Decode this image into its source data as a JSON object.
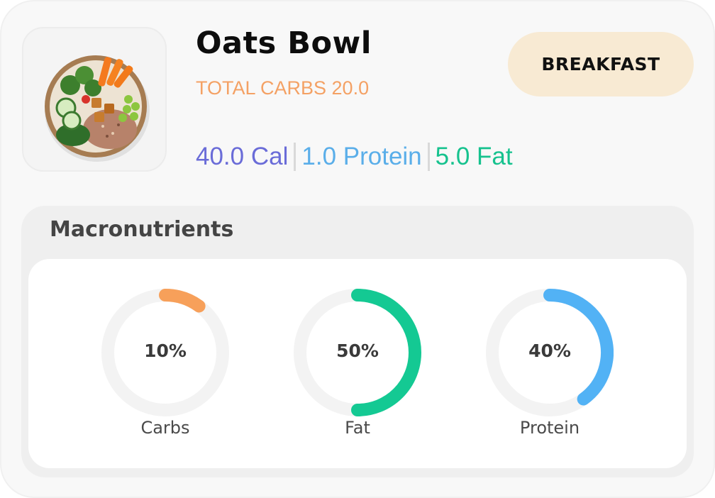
{
  "meal": {
    "title": "Oats Bowl",
    "total_carbs": "TOTAL CARBS 20.0",
    "category": "BREAKFAST",
    "image_icon": "food-bowl-image"
  },
  "stats": {
    "calories": "40.0 Cal",
    "protein": "1.0 Protein",
    "fat": "5.0 Fat"
  },
  "macros": {
    "heading": "Macronutrients",
    "items": [
      {
        "key": "carbs",
        "label": "Carbs",
        "percent_text": "10%",
        "percent": 10,
        "color": "#f7a05a"
      },
      {
        "key": "fat",
        "label": "Fat",
        "percent_text": "50%",
        "percent": 50,
        "color": "#14c993"
      },
      {
        "key": "protein",
        "label": "Protein",
        "percent_text": "40%",
        "percent": 40,
        "color": "#52b2f5"
      }
    ],
    "track_color": "#f3f3f3"
  },
  "colors": {
    "calories": "#6a6cd8",
    "protein": "#5aaee9",
    "fat": "#16c28e",
    "carbs": "#f4a164",
    "badge_bg": "#f8ead3"
  }
}
